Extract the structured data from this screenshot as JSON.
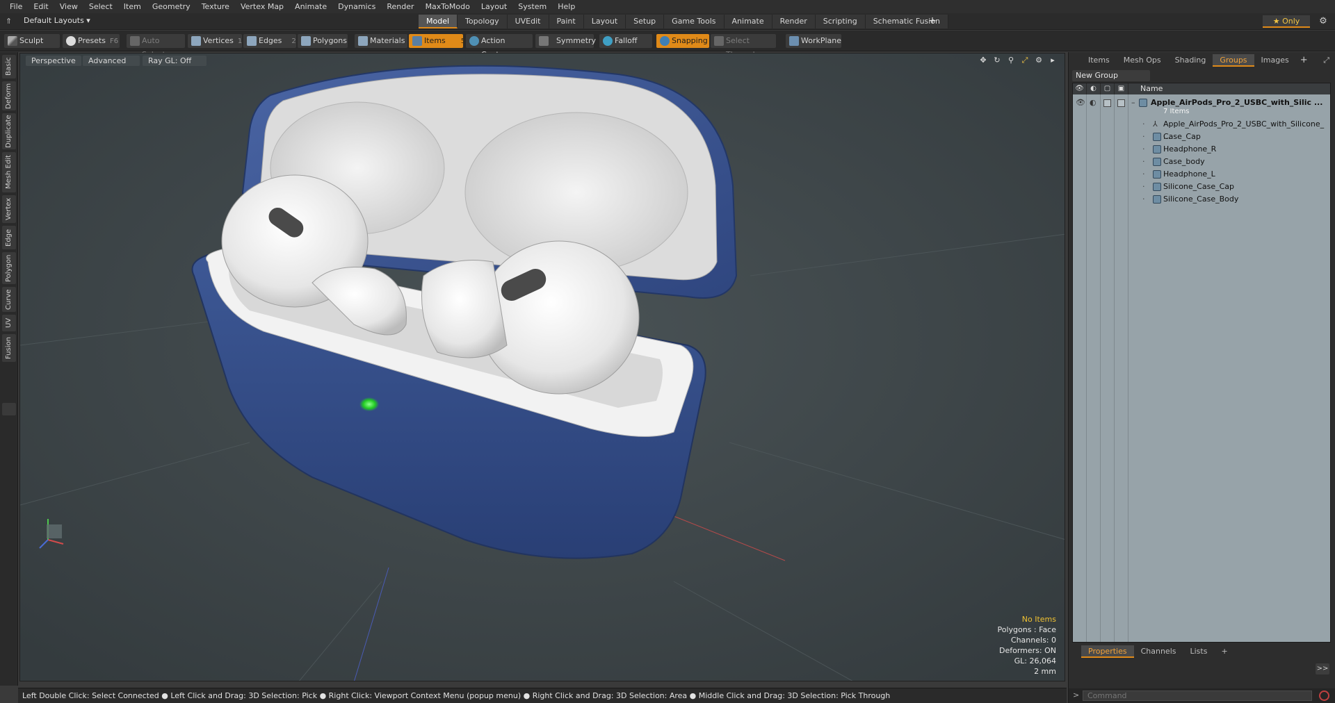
{
  "menubar": {
    "items": [
      "File",
      "Edit",
      "View",
      "Select",
      "Item",
      "Geometry",
      "Texture",
      "Vertex Map",
      "Animate",
      "Dynamics",
      "Render",
      "MaxToModo",
      "Layout",
      "System",
      "Help"
    ]
  },
  "layoutbar": {
    "layout_select": "Default Layouts ▾",
    "tabs": [
      "Model",
      "Topology",
      "UVEdit",
      "Paint",
      "Layout",
      "Setup",
      "Game Tools",
      "Animate",
      "Render",
      "Scripting",
      "Schematic Fusion"
    ],
    "active_tab": "Model",
    "only_label": "★  Only"
  },
  "toolbar": {
    "sculpt": "Sculpt",
    "presets": "Presets",
    "presets_key": "F6",
    "auto_select": "Auto Select",
    "vertices": "Vertices",
    "vertices_count": "1",
    "edges": "Edges",
    "edges_count": "2",
    "polygons": "Polygons",
    "materials": "Materials",
    "items": "Items",
    "items_count": "5",
    "action_center": "Action Center",
    "symmetry": "Symmetry",
    "falloff": "Falloff",
    "snapping": "Snapping",
    "select_through": "Select Through",
    "workplane": "WorkPlane",
    "accent": "#e08a18"
  },
  "left_tabs": [
    "Basic",
    "Deform",
    "Duplicate",
    "Mesh Edit",
    "Vertex",
    "Edge",
    "Polygon",
    "Curve",
    "UV",
    "Fusion"
  ],
  "viewport": {
    "view_mode": "Perspective",
    "shading": "Advanced",
    "raygl": "Ray GL: Off",
    "info": {
      "items": "No Items",
      "polygons": "Polygons : Face",
      "channels": "Channels: 0",
      "deformers": "Deformers: ON",
      "gl": "GL: 26,064",
      "scale": "2 mm"
    }
  },
  "statusbar": {
    "text": "Left Double Click: Select Connected ● Left Click and Drag: 3D Selection: Pick ● Right Click: Viewport Context Menu (popup menu) ● Right Click and Drag: 3D Selection: Area ● Middle Click and Drag: 3D Selection: Pick Through"
  },
  "rightpanel": {
    "tabs": [
      "Items",
      "Mesh Ops",
      "Shading",
      "Groups",
      "Images"
    ],
    "active_tab": "Groups",
    "new_group": "New Group",
    "name_header": "Name",
    "group": {
      "title": "Apple_AirPods_Pro_2_USBC_with_Silic ...",
      "count": "7 Items",
      "children": [
        "Apple_AirPods_Pro_2_USBC_with_Silicone_ ...",
        "Case_Cap",
        "Headphone_R",
        "Case_body",
        "Headphone_L",
        "Silicone_Case_Cap",
        "Silicone_Case_Body"
      ]
    },
    "bottom_tabs": [
      "Properties",
      "Channels",
      "Lists"
    ],
    "bottom_active": "Properties",
    "expand": ">>",
    "command_placeholder": "Command"
  }
}
